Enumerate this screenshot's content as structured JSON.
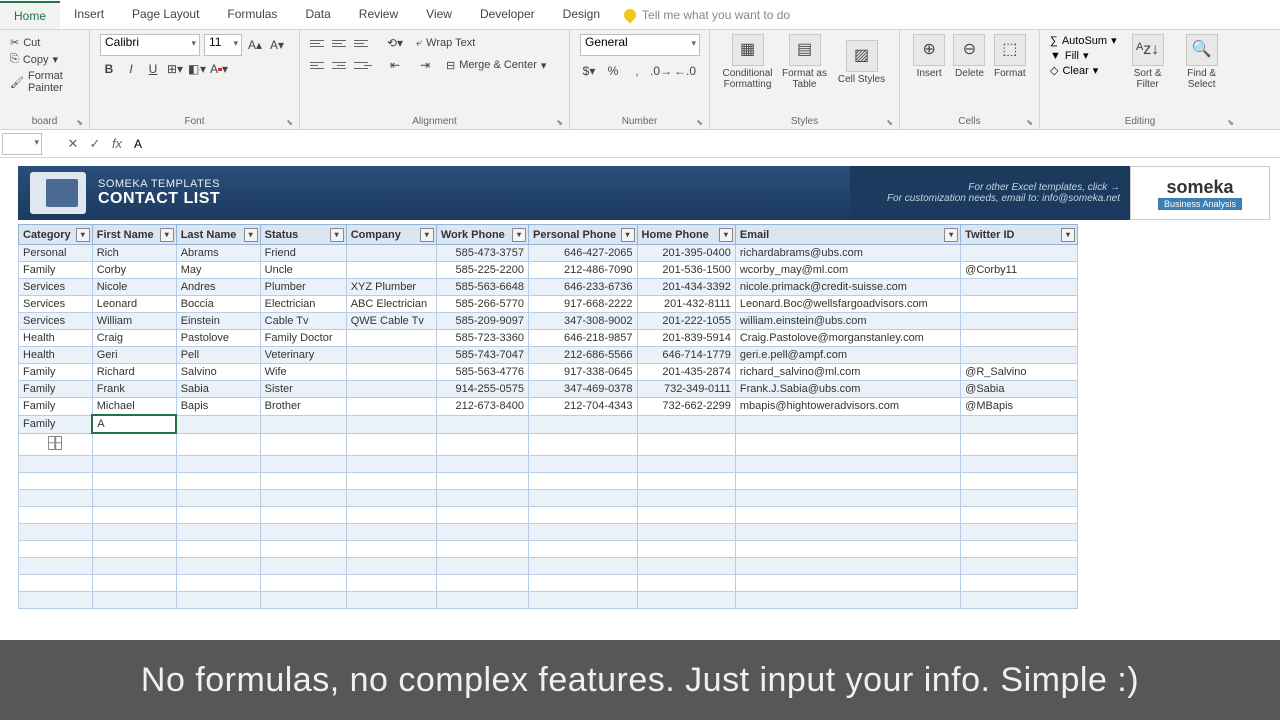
{
  "tabs": [
    "Home",
    "Insert",
    "Page Layout",
    "Formulas",
    "Data",
    "Review",
    "View",
    "Developer",
    "Design"
  ],
  "active_tab": "Home",
  "tell_me": "Tell me what you want to do",
  "clipboard": {
    "cut": "Cut",
    "copy": "Copy",
    "paint": "Format Painter",
    "label": "board"
  },
  "font": {
    "name": "Calibri",
    "size": "11",
    "label": "Font"
  },
  "alignment": {
    "wrap": "Wrap Text",
    "merge": "Merge & Center",
    "label": "Alignment"
  },
  "number": {
    "format": "General",
    "label": "Number"
  },
  "styles": {
    "cf": "Conditional Formatting",
    "fat": "Format as Table",
    "cs": "Cell Styles",
    "label": "Styles"
  },
  "cells": {
    "insert": "Insert",
    "delete": "Delete",
    "format": "Format",
    "label": "Cells"
  },
  "editing": {
    "autosum": "AutoSum",
    "fill": "Fill",
    "clear": "Clear",
    "sort": "Sort & Filter",
    "find": "Find & Select",
    "label": "Editing"
  },
  "formula_value": "A",
  "template": {
    "brand": "SOMEKA TEMPLATES",
    "title": "CONTACT LIST",
    "line1": "For other Excel templates, click →",
    "line2": "For customization needs, email to: info@someka.net",
    "logo": "someka",
    "logo_sub": "Business Analysis"
  },
  "columns": [
    "Category",
    "First Name",
    "Last Name",
    "Status",
    "Company",
    "Work Phone",
    "Personal Phone",
    "Home Phone",
    "Email",
    "Twitter ID"
  ],
  "rows": [
    {
      "cat": "Personal",
      "fn": "Rich",
      "ln": "Abrams",
      "st": "Friend",
      "co": "",
      "wp": "585-473-3757",
      "pp": "646-427-2065",
      "hp": "201-395-0400",
      "em": "richardabrams@ubs.com",
      "tw": ""
    },
    {
      "cat": "Family",
      "fn": "Corby",
      "ln": "May",
      "st": "Uncle",
      "co": "",
      "wp": "585-225-2200",
      "pp": "212-486-7090",
      "hp": "201-536-1500",
      "em": "wcorby_may@ml.com",
      "tw": "@Corby11"
    },
    {
      "cat": "Services",
      "fn": "Nicole",
      "ln": "Andres",
      "st": "Plumber",
      "co": "XYZ Plumber",
      "wp": "585-563-6648",
      "pp": "646-233-6736",
      "hp": "201-434-3392",
      "em": "nicole.primack@credit-suisse.com",
      "tw": ""
    },
    {
      "cat": "Services",
      "fn": "Leonard",
      "ln": "Boccia",
      "st": "Electrician",
      "co": "ABC Electrician",
      "wp": "585-266-5770",
      "pp": "917-668-2222",
      "hp": "201-432-8111",
      "em": "Leonard.Boc@wellsfargoadvisors.com",
      "tw": ""
    },
    {
      "cat": "Services",
      "fn": "William",
      "ln": "Einstein",
      "st": "Cable Tv",
      "co": "QWE Cable Tv",
      "wp": "585-209-9097",
      "pp": "347-308-9002",
      "hp": "201-222-1055",
      "em": "william.einstein@ubs.com",
      "tw": ""
    },
    {
      "cat": "Health",
      "fn": "Craig",
      "ln": "Pastolove",
      "st": "Family Doctor",
      "co": "",
      "wp": "585-723-3360",
      "pp": "646-218-9857",
      "hp": "201-839-5914",
      "em": "Craig.Pastolove@morganstanley.com",
      "tw": ""
    },
    {
      "cat": "Health",
      "fn": "Geri",
      "ln": "Pell",
      "st": "Veterinary",
      "co": "",
      "wp": "585-743-7047",
      "pp": "212-686-5566",
      "hp": "646-714-1779",
      "em": "geri.e.pell@ampf.com",
      "tw": ""
    },
    {
      "cat": "Family",
      "fn": "Richard",
      "ln": "Salvino",
      "st": "Wife",
      "co": "",
      "wp": "585-563-4776",
      "pp": "917-338-0645",
      "hp": "201-435-2874",
      "em": "richard_salvino@ml.com",
      "tw": "@R_Salvino"
    },
    {
      "cat": "Family",
      "fn": "Frank",
      "ln": "Sabia",
      "st": "Sister",
      "co": "",
      "wp": "914-255-0575",
      "pp": "347-469-0378",
      "hp": "732-349-0111",
      "em": "Frank.J.Sabia@ubs.com",
      "tw": "@Sabia"
    },
    {
      "cat": "Family",
      "fn": "Michael",
      "ln": "Bapis",
      "st": "Brother",
      "co": "",
      "wp": "212-673-8400",
      "pp": "212-704-4343",
      "hp": "732-662-2299",
      "em": "mbapis@hightoweradvisors.com",
      "tw": "@MBapis"
    }
  ],
  "editing_row": {
    "cat": "Family",
    "fn": "A"
  },
  "empty_rows": 10,
  "overlay": "No formulas, no complex features. Just input your info. Simple :)"
}
